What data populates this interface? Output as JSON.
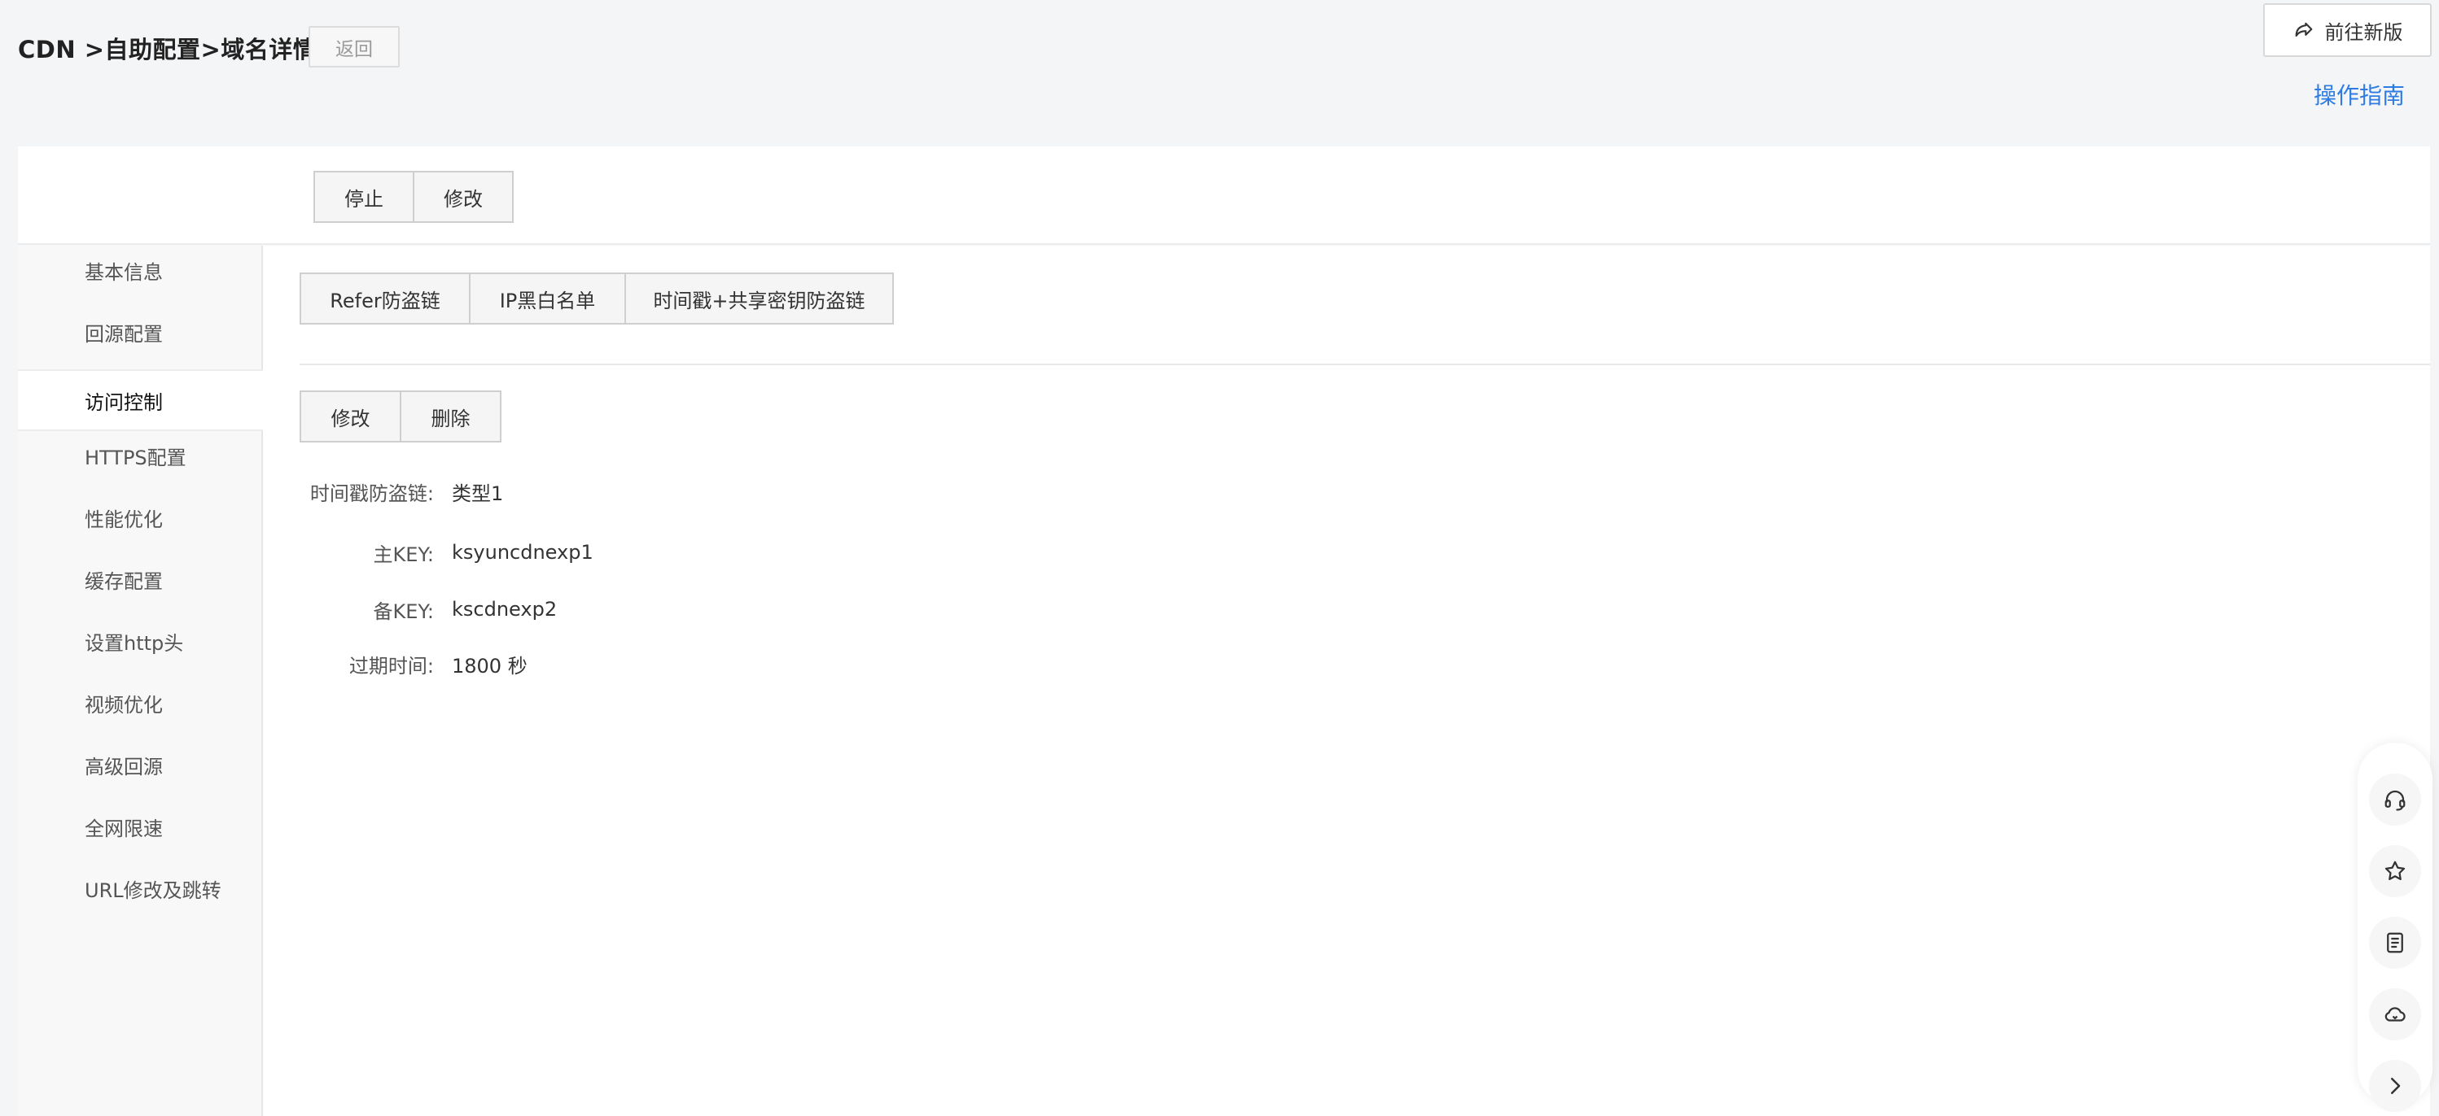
{
  "header": {
    "breadcrumb": "CDN >自助配置>域名详情",
    "back_label": "返回",
    "new_version_label": "前往新版",
    "guide_label": "操作指南"
  },
  "actions": {
    "stop_label": "停止",
    "modify_label": "修改"
  },
  "sidebar": {
    "items": [
      {
        "label": "基本信息"
      },
      {
        "label": "回源配置"
      },
      {
        "label": "访问控制",
        "active": true
      },
      {
        "label": "HTTPS配置"
      },
      {
        "label": "性能优化"
      },
      {
        "label": "缓存配置"
      },
      {
        "label": "设置http头"
      },
      {
        "label": "视频优化"
      },
      {
        "label": "高级回源"
      },
      {
        "label": "全网限速"
      },
      {
        "label": "URL修改及跳转"
      }
    ]
  },
  "main": {
    "tabs": [
      {
        "label": "Refer防盗链"
      },
      {
        "label": "IP黑白名单"
      },
      {
        "label": "时间戳+共享密钥防盗链"
      }
    ],
    "edit_label": "修改",
    "delete_label": "删除",
    "info": [
      {
        "label": "时间戳防盗链:",
        "value": "类型1"
      },
      {
        "label": "主KEY:",
        "value": "ksyuncdnexp1"
      },
      {
        "label": "备KEY:",
        "value": "kscdnexp2"
      },
      {
        "label": "过期时间:",
        "value": "1800 秒"
      }
    ]
  },
  "float_tools": [
    {
      "icon": "headset-icon"
    },
    {
      "icon": "star-icon"
    },
    {
      "icon": "document-icon"
    },
    {
      "icon": "cloud-icon"
    },
    {
      "icon": "chevron-right-icon"
    }
  ]
}
